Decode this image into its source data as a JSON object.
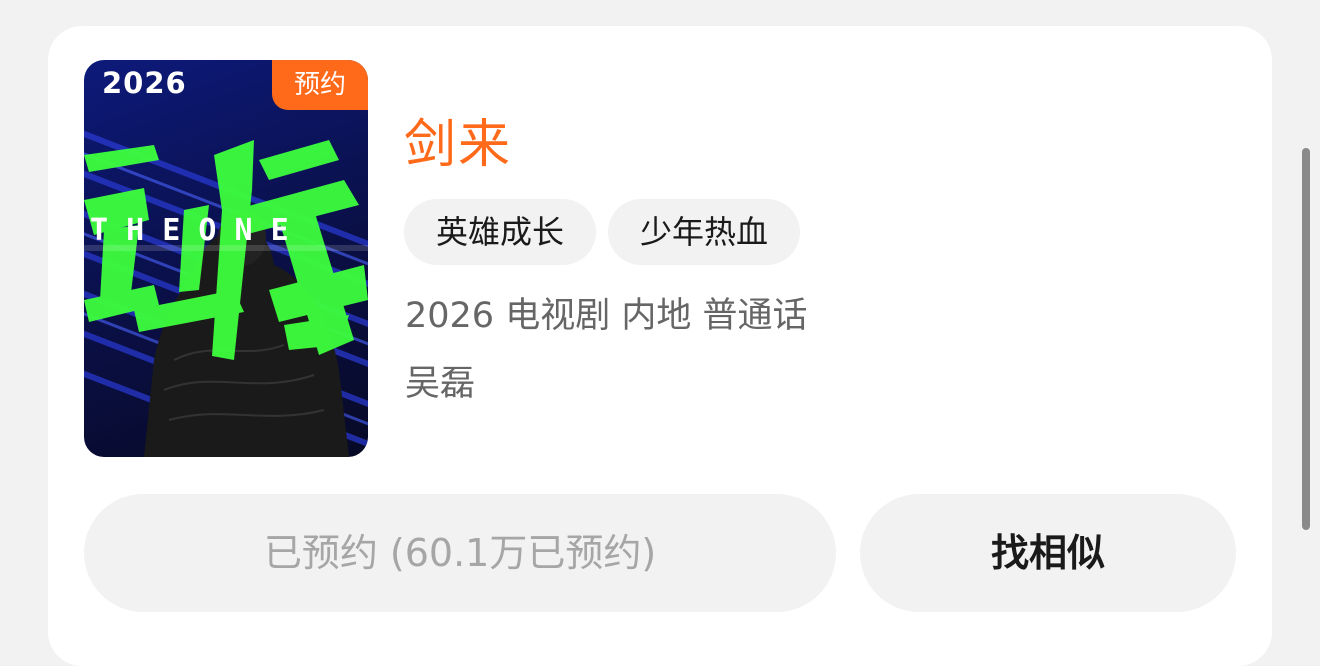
{
  "card": {
    "poster": {
      "year": "2026",
      "badge": "预约",
      "overlay_text": "THE ONE",
      "badge_color": "#ff6a1a"
    },
    "title": "剑来",
    "tags": [
      "英雄成长",
      "少年热血"
    ],
    "meta": "2026 电视剧 内地 普通话",
    "actor": "吴磊",
    "buttons": {
      "reserved_label": "已预约 (60.1万已预约)",
      "similar_label": "找相似"
    }
  },
  "colors": {
    "accent": "#ff6a1a",
    "background": "#f2f2f2",
    "card": "#ffffff"
  }
}
